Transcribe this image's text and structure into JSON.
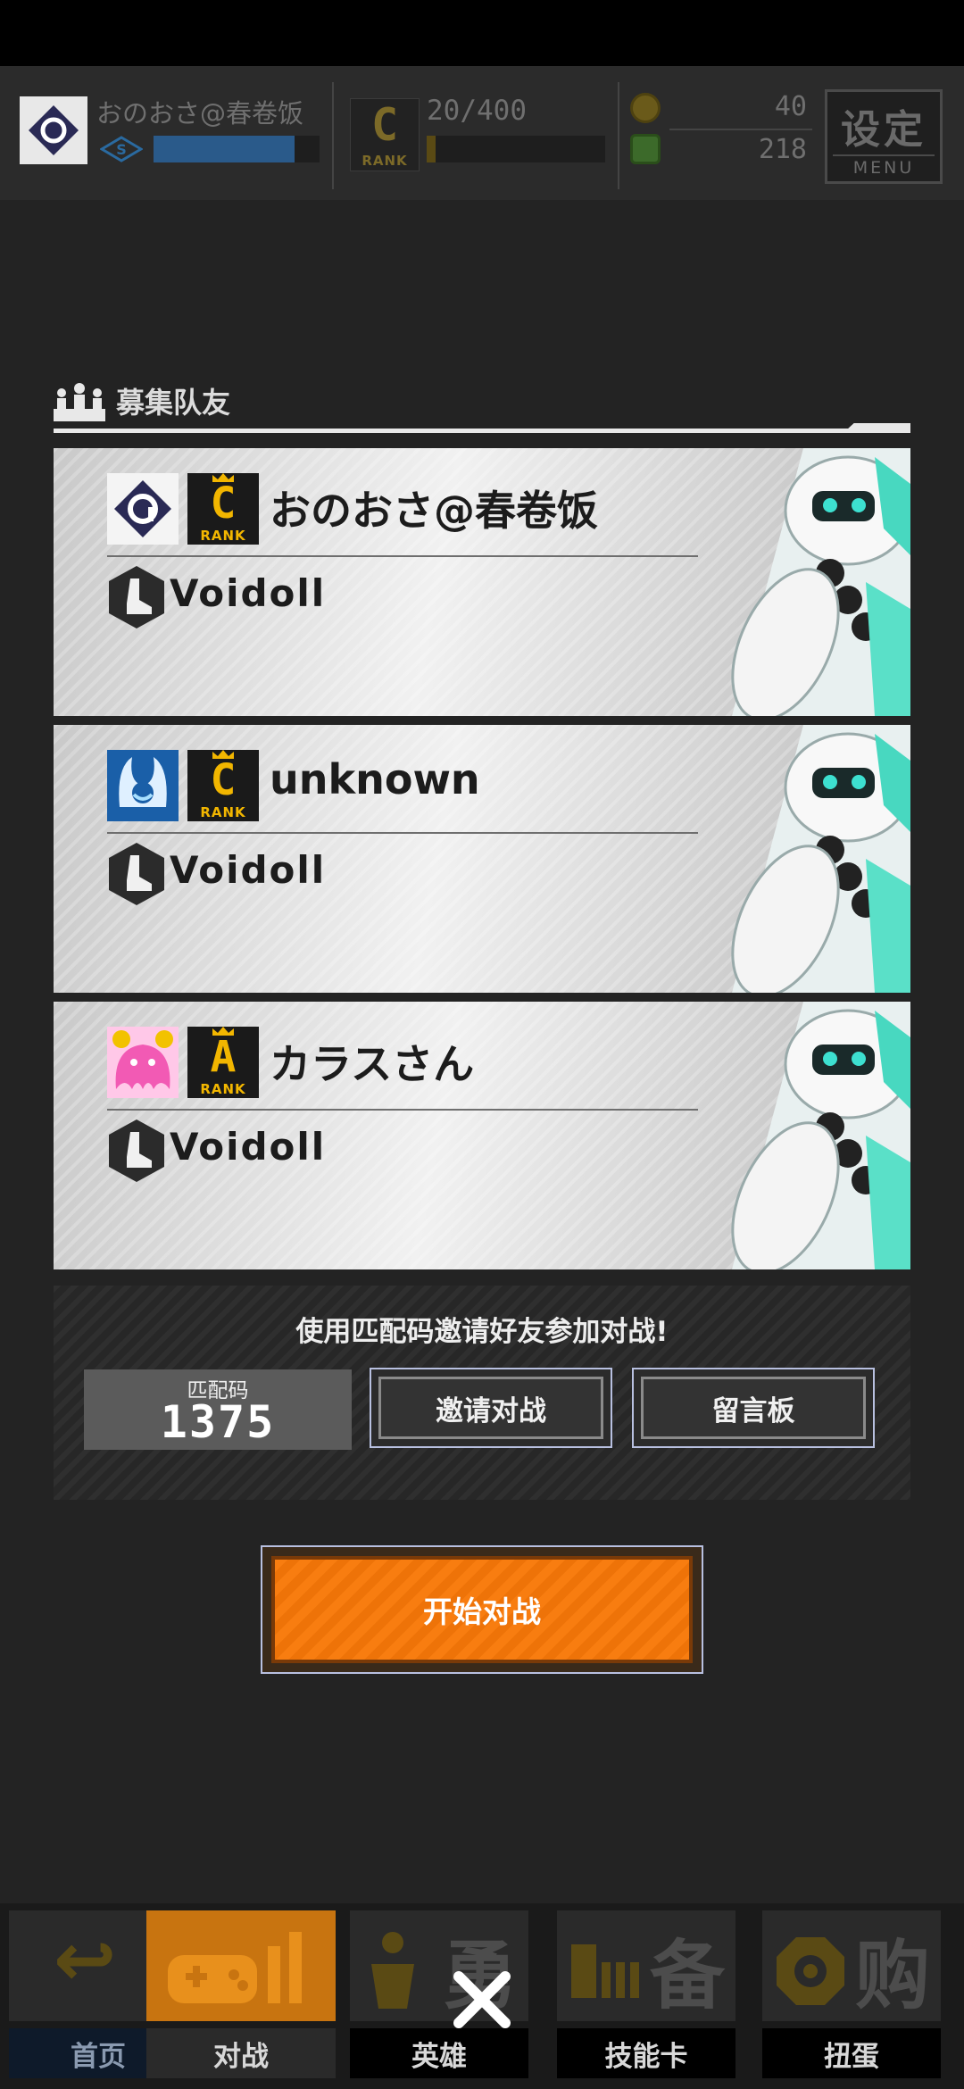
{
  "header": {
    "player_name": "おのおさ@春卷饭",
    "exp": "20/400",
    "rank_letter": "C",
    "rank_label": "RANK",
    "currency_gold": "40",
    "currency_green": "218",
    "menu_big": "设定",
    "menu_small": "MENU",
    "level_progress": 0.85,
    "exp_progress": 0.05
  },
  "section": {
    "title": "募集队友"
  },
  "players": [
    {
      "name": "おのおさ@春卷饭",
      "rank_letter": "C",
      "rank_label": "RANK",
      "hero": "Voidoll",
      "avatar_icon": "ability-logo-icon"
    },
    {
      "name": "unknown",
      "rank_letter": "C",
      "rank_label": "RANK",
      "hero": "Voidoll",
      "avatar_icon": "blue-character-icon"
    },
    {
      "name": "カラスさん",
      "rank_letter": "A",
      "rank_label": "RANK",
      "hero": "Voidoll",
      "avatar_icon": "pink-character-icon"
    }
  ],
  "match": {
    "message": "使用匹配码邀请好友参加对战!",
    "code_label": "匹配码",
    "code_value": "1375",
    "invite_label": "邀请对战",
    "board_label": "留言板"
  },
  "start_button": "开始对战",
  "nav": [
    {
      "label": "首页",
      "glyph": "↩",
      "active": false
    },
    {
      "label": "对战",
      "glyph": "",
      "active": true
    },
    {
      "label": "英雄",
      "glyph": "勇",
      "active": false
    },
    {
      "label": "技能卡",
      "glyph": "备",
      "active": false
    },
    {
      "label": "扭蛋",
      "glyph": "购",
      "active": false
    }
  ],
  "colors": {
    "accent_orange": "#f87d10",
    "rank_gold": "#f2b600",
    "active_nav": "#d27a10"
  }
}
